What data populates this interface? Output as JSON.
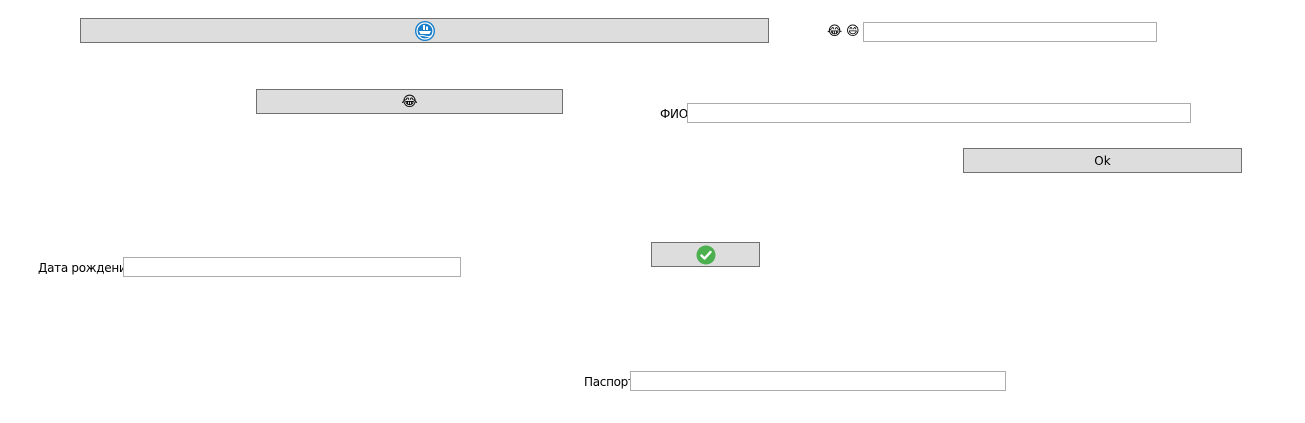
{
  "colors": {
    "button_bg": "#dddddd",
    "button_border": "#707070",
    "input_border": "#acacac",
    "ship_icon_blue": "#1a7fc9",
    "check_icon_green": "#4caf50"
  },
  "top_button": {
    "icon": "ship-badge-icon"
  },
  "emoji_button": {
    "glyph": "😂"
  },
  "emoji_labels": {
    "first": "😂",
    "second": "😄"
  },
  "emoji_field": {
    "value": ""
  },
  "fio": {
    "label": "ФИО",
    "value": ""
  },
  "ok_button": {
    "label": "Ok"
  },
  "check_button": {
    "icon": "green-check-icon"
  },
  "birth_date": {
    "label": "Дата рождения",
    "value": ""
  },
  "passport": {
    "label": "Паспорт",
    "value": ""
  }
}
